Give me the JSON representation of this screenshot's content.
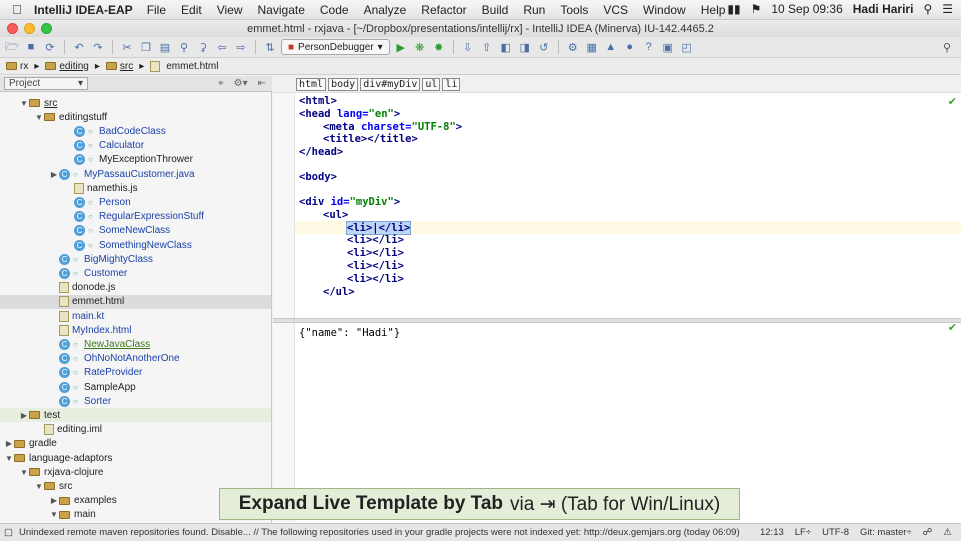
{
  "menubar": {
    "app": "IntelliJ IDEA-EAP",
    "items": [
      "File",
      "Edit",
      "View",
      "Navigate",
      "Code",
      "Analyze",
      "Refactor",
      "Build",
      "Run",
      "Tools",
      "VCS",
      "Window",
      "Help"
    ],
    "datetime": "10 Sep  09:36",
    "user": "Hadi Hariri"
  },
  "window": {
    "title": "emmet.html - rxjava - [~/Dropbox/presentations/intellij/rx] - IntelliJ IDEA (Minerva) IU-142.4465.2"
  },
  "toolbar": {
    "run_config": "PersonDebugger"
  },
  "breadcrumb": [
    "rx",
    "editing",
    "src",
    "emmet.html"
  ],
  "project": {
    "view_label": "Project",
    "tree": [
      {
        "label": "src",
        "indent": 1,
        "arrow": "down",
        "icon": "folder",
        "style": "underline"
      },
      {
        "label": "editingstuff",
        "indent": 2,
        "arrow": "down",
        "icon": "folder",
        "style": ""
      },
      {
        "label": "BadCodeClass",
        "indent": 4,
        "arrow": "",
        "icon": "class",
        "style": "blue"
      },
      {
        "label": "Calculator",
        "indent": 4,
        "arrow": "",
        "icon": "class",
        "style": "blue"
      },
      {
        "label": "MyExceptionThrower",
        "indent": 4,
        "arrow": "",
        "icon": "class",
        "style": ""
      },
      {
        "label": "MyPassauCustomer.java",
        "indent": 3,
        "arrow": "right",
        "icon": "class",
        "style": "blue"
      },
      {
        "label": "namethis.js",
        "indent": 4,
        "arrow": "",
        "icon": "file",
        "style": ""
      },
      {
        "label": "Person",
        "indent": 4,
        "arrow": "",
        "icon": "class",
        "style": "blue"
      },
      {
        "label": "RegularExpressionStuff",
        "indent": 4,
        "arrow": "",
        "icon": "class",
        "style": "blue"
      },
      {
        "label": "SomeNewClass",
        "indent": 4,
        "arrow": "",
        "icon": "class",
        "style": "blue"
      },
      {
        "label": "SomethingNewClass",
        "indent": 4,
        "arrow": "",
        "icon": "class",
        "style": "blue"
      },
      {
        "label": "BigMightyClass",
        "indent": 3,
        "arrow": "",
        "icon": "class",
        "style": "blue"
      },
      {
        "label": "Customer",
        "indent": 3,
        "arrow": "",
        "icon": "class",
        "style": "blue"
      },
      {
        "label": "donode.js",
        "indent": 3,
        "arrow": "",
        "icon": "file",
        "style": ""
      },
      {
        "label": "emmet.html",
        "indent": 3,
        "arrow": "",
        "icon": "file",
        "style": "",
        "selected": true
      },
      {
        "label": "main.kt",
        "indent": 3,
        "arrow": "",
        "icon": "file",
        "style": "blue"
      },
      {
        "label": "MyIndex.html",
        "indent": 3,
        "arrow": "",
        "icon": "file",
        "style": "blue"
      },
      {
        "label": "NewJavaClass",
        "indent": 3,
        "arrow": "",
        "icon": "class",
        "style": "green-underline"
      },
      {
        "label": "OhNoNotAnotherOne",
        "indent": 3,
        "arrow": "",
        "icon": "class",
        "style": "blue"
      },
      {
        "label": "RateProvider",
        "indent": 3,
        "arrow": "",
        "icon": "class",
        "style": "blue"
      },
      {
        "label": "SampleApp",
        "indent": 3,
        "arrow": "",
        "icon": "class",
        "style": ""
      },
      {
        "label": "Sorter",
        "indent": 3,
        "arrow": "",
        "icon": "class",
        "style": "blue"
      },
      {
        "label": "test",
        "indent": 1,
        "arrow": "right",
        "icon": "folder",
        "style": "",
        "tinted": true
      },
      {
        "label": "editing.iml",
        "indent": 2,
        "arrow": "",
        "icon": "file",
        "style": ""
      },
      {
        "label": "gradle",
        "indent": 0,
        "arrow": "right",
        "icon": "folder",
        "style": ""
      },
      {
        "label": "language-adaptors",
        "indent": 0,
        "arrow": "down",
        "icon": "folder",
        "style": ""
      },
      {
        "label": "rxjava-clojure",
        "indent": 1,
        "arrow": "down",
        "icon": "folder",
        "style": ""
      },
      {
        "label": "src",
        "indent": 2,
        "arrow": "down",
        "icon": "folder",
        "style": ""
      },
      {
        "label": "examples",
        "indent": 3,
        "arrow": "right",
        "icon": "folder",
        "style": ""
      },
      {
        "label": "main",
        "indent": 3,
        "arrow": "down",
        "icon": "folder",
        "style": ""
      }
    ]
  },
  "editor": {
    "tag_path": [
      "html",
      "body",
      "div#myDiv",
      "ul",
      "li"
    ],
    "lines": {
      "l1": "<html>",
      "l2a": "<head ",
      "l2b": "lang=",
      "l2c": "\"en\"",
      "l2d": ">",
      "l3a": "<meta ",
      "l3b": "charset=",
      "l3c": "\"UTF-8\"",
      "l3d": ">",
      "l4": "<title></title>",
      "l5": "</head>",
      "l7": "<body>",
      "l9a": "<div ",
      "l9b": "id=",
      "l9c": "\"myDiv\"",
      "l9d": ">",
      "l10": "<ul>",
      "l11": "<li>|</li>",
      "l12": "<li></li>",
      "l13": "<li></li>",
      "l14": "<li></li>",
      "l15": "<li></li>",
      "l16": "</ul>"
    },
    "scratch_line": "{\"name\": \"Hadi\"}"
  },
  "statusbar": {
    "message": "Unindexed remote maven repositories found. Disable... // The following repositories used in your gradle projects were not indexed yet: http://deux.gemjars.org (today 06:09)",
    "position": "12:13",
    "line_sep": "LF÷",
    "encoding": "UTF-8",
    "vcs": "Git: master÷"
  },
  "tip": {
    "bold": "Expand Live Template by Tab",
    "rest": "via ⇥ (Tab for Win/Linux)"
  }
}
